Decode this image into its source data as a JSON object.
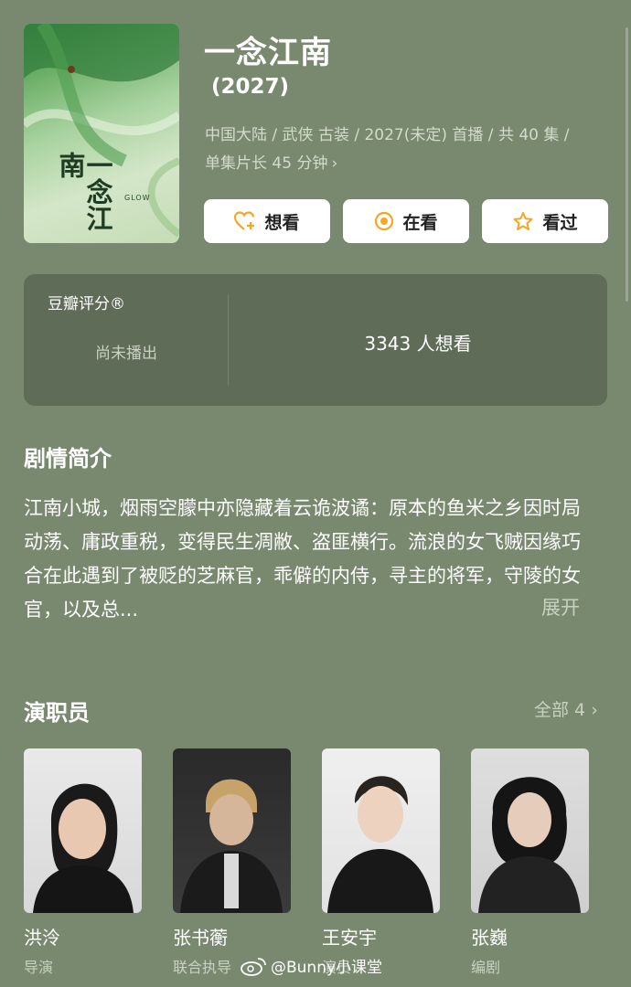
{
  "show": {
    "title": "一念江南",
    "year": "(2027)",
    "meta_line1": "中国大陆 / 武侠 古装 / 2027(未定) 首播 / 共 40 集 /",
    "meta_line2": "单集片长 45 分钟",
    "poster_title": "一念江南",
    "poster_tag": "GLOW"
  },
  "actions": {
    "want": "想看",
    "watching": "在看",
    "watched": "看过"
  },
  "rating": {
    "label": "豆瓣评分®",
    "status": "尚未播出",
    "wish_count": "3343 人想看"
  },
  "synopsis": {
    "heading": "剧情简介",
    "text": "江南小城，烟雨空朦中亦隐藏着云诡波谲：原本的鱼米之乡因时局动荡、庸政重税，变得民生凋敝、盗匪横行。流浪的女飞贼因缘巧合在此遇到了被贬的芝麻官，乖僻的内侍，寻主的将军，守陵的女官，以及总...",
    "expand": "展开"
  },
  "cast": {
    "heading": "演职员",
    "all_label": "全部 4",
    "members": [
      {
        "name": "洪泠",
        "role": "导演"
      },
      {
        "name": "张书蘅",
        "role": "联合执导"
      },
      {
        "name": "王安宇",
        "role": "演员"
      },
      {
        "name": "张巍",
        "role": "编剧"
      }
    ]
  },
  "watermark": "@Bunny小课堂",
  "colors": {
    "background": "#78896f",
    "card": "#5f6c58",
    "accent": "#f5a623"
  }
}
